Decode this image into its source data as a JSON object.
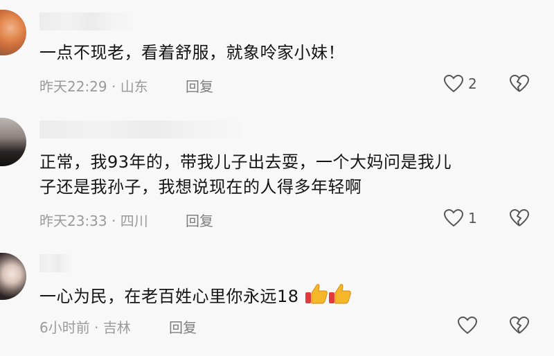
{
  "comments": [
    {
      "text_lines": [
        "一点不现老，看着舒服，就象呤家小妹！"
      ],
      "time": "昨天22:29",
      "separator": "·",
      "location": "山东",
      "reply_label": "回复",
      "like_count": "2"
    },
    {
      "text_lines": [
        "正常，我93年的，带我儿子出去耍，一个大妈问是我儿",
        "子还是我孙子，我想说现在的人得多年轻啊"
      ],
      "time": "昨天23:33",
      "separator": "·",
      "location": "四川",
      "reply_label": "回复",
      "like_count": "1"
    },
    {
      "text_lines": [
        "一心为民，在老百姓心里你永远18"
      ],
      "time": "6小时前",
      "separator": "·",
      "location": "吉林",
      "reply_label": "回复",
      "like_count": ""
    }
  ],
  "icons": {
    "like": "heart-outline-icon",
    "dislike": "broken-heart-icon",
    "emoji": "thumbs-up-emoji"
  },
  "colors": {
    "background": "#f8f8f8",
    "text": "#141414",
    "meta": "#9a9a9a",
    "icon": "#555555"
  }
}
